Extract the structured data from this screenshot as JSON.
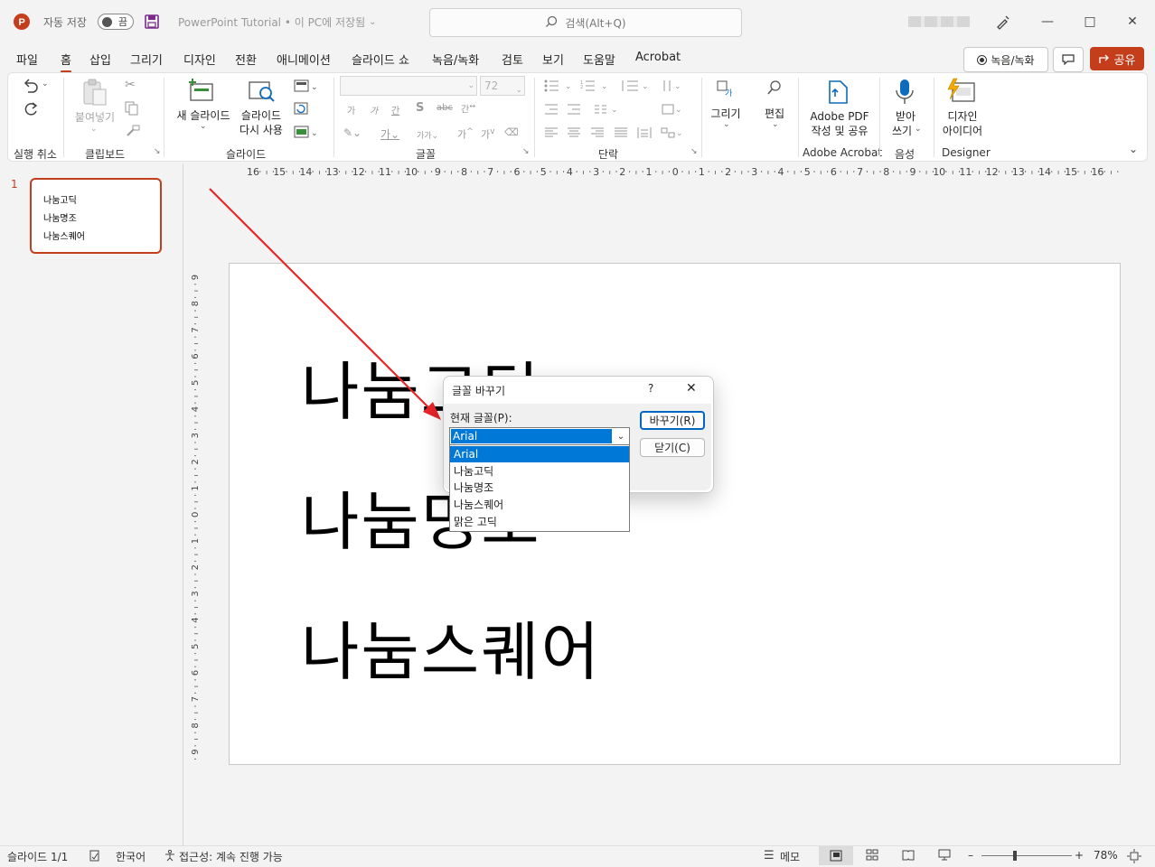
{
  "titlebar": {
    "autosave_label": "자동 저장",
    "autosave_state": "끔",
    "doc_title": "PowerPoint Tutorial • 이 PC에 저장됨",
    "search_placeholder": "검색(Alt+Q)"
  },
  "menu": {
    "tabs": [
      "파일",
      "홈",
      "삽입",
      "그리기",
      "디자인",
      "전환",
      "애니메이션",
      "슬라이드 쇼",
      "녹음/녹화",
      "검토",
      "보기",
      "도움말",
      "Acrobat"
    ],
    "active": "홈",
    "record_button": "녹음/녹화",
    "share_button": "공유"
  },
  "ribbon": {
    "paste": "붙여넣기",
    "new_slide": "새 슬라이드",
    "reuse_slide_1": "슬라이드",
    "reuse_slide_2": "다시 사용",
    "font_size": "72",
    "drawing": "그리기",
    "editing": "편집",
    "adobe_pdf_1": "Adobe PDF",
    "adobe_pdf_2": "작성 및 공유",
    "dictate_1": "받아",
    "dictate_2": "쓰기",
    "designer_1": "디자인",
    "designer_2": "아이디어",
    "groups": {
      "undo": "실행 취소",
      "clipboard": "클립보드",
      "slides": "슬라이드",
      "font": "글꼴",
      "paragraph": "단락",
      "acrobat": "Adobe Acrobat",
      "voice": "음성",
      "designer": "Designer"
    }
  },
  "slide_panel": {
    "slide_number": "1",
    "thumb_lines": [
      "나눔고딕",
      "나눔명조",
      "나눔스퀘어"
    ]
  },
  "slide": {
    "lines": [
      "나눔고딕",
      "나눔명조",
      "나눔스퀘어"
    ]
  },
  "dialog": {
    "title": "글꼴 바꾸기",
    "help": "?",
    "close": "✕",
    "current_font_label": "현재 글꼴(P):",
    "current_font_value": "Arial",
    "replace_button": "바꾸기(R)",
    "close_button": "닫기(C)",
    "font_options": [
      "Arial",
      "나눔고딕",
      "나눔명조",
      "나눔스퀘어",
      "맑은 고딕"
    ],
    "selected_index": 0
  },
  "ruler": {
    "h_ticks": [
      "16",
      "15",
      "14",
      "13",
      "12",
      "11",
      "10",
      "9",
      "8",
      "7",
      "6",
      "5",
      "4",
      "3",
      "2",
      "1",
      "0",
      "1",
      "2",
      "3",
      "4",
      "5",
      "6",
      "7",
      "8",
      "9",
      "10",
      "11",
      "12",
      "13",
      "14",
      "15",
      "16"
    ],
    "v_ticks": [
      "9",
      "8",
      "7",
      "6",
      "5",
      "4",
      "3",
      "2",
      "1",
      "0",
      "1",
      "2",
      "3",
      "4",
      "5",
      "6",
      "7",
      "8",
      "9"
    ]
  },
  "statusbar": {
    "slide_count": "슬라이드 1/1",
    "language": "한국어",
    "accessibility": "접근성: 계속 진행 가능",
    "notes": "메모",
    "zoom": "78%"
  },
  "colors": {
    "accent": "#c43e1c",
    "selection": "#0078d7",
    "arrow": "#e8262a"
  }
}
